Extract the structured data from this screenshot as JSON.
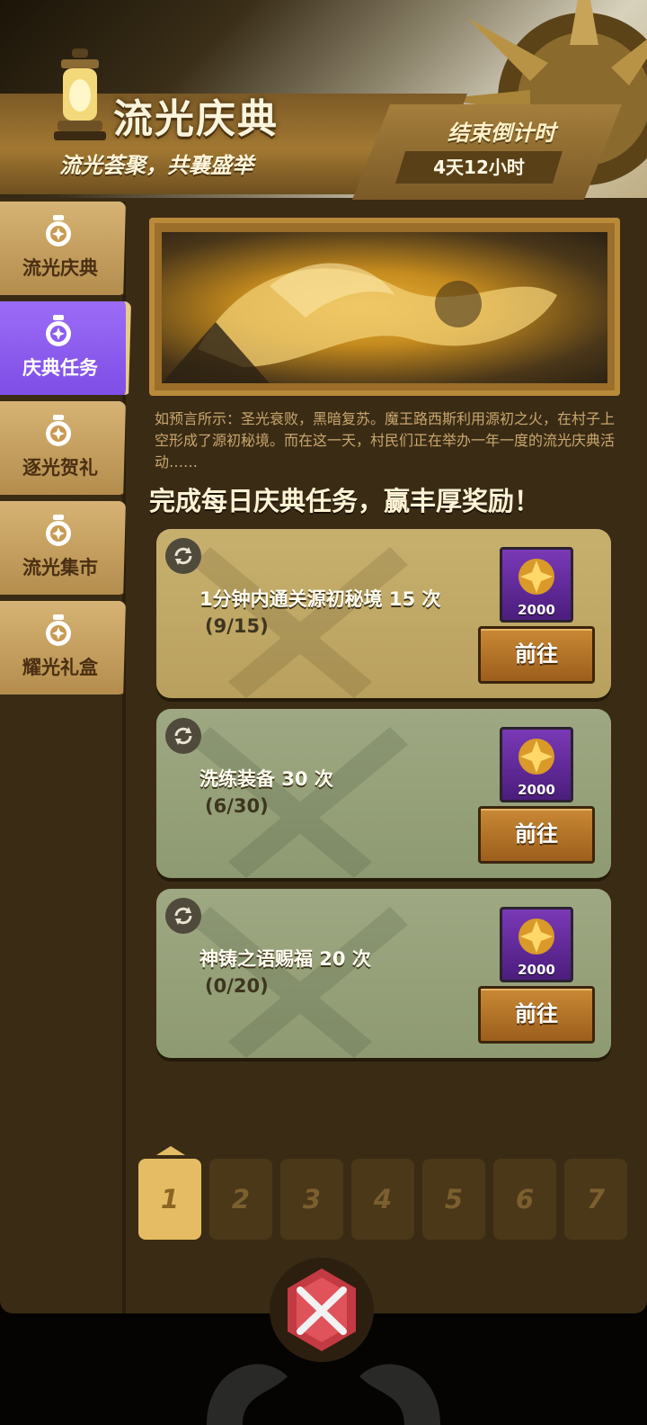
{
  "header": {
    "title": "流光庆典",
    "subtitle": "流光荟聚，共襄盛举",
    "countdown_label": "结束倒计时",
    "countdown_value": "4天12小时"
  },
  "sidebar": {
    "items": [
      {
        "label": "流光庆典",
        "icon": "lantern-badge-icon",
        "active": false
      },
      {
        "label": "庆典任务",
        "icon": "lantern-badge-icon",
        "active": true
      },
      {
        "label": "逐光贺礼",
        "icon": "lantern-badge-icon",
        "active": false
      },
      {
        "label": "流光集市",
        "icon": "lantern-badge-icon",
        "active": false
      },
      {
        "label": "耀光礼盒",
        "icon": "lantern-badge-icon",
        "active": false
      }
    ]
  },
  "story": "如预言所示：圣光衰败，黑暗复苏。魔王路西斯利用源初之火，在村子上空形成了源初秘境。而在这一天，村民们正在举办一年一度的流光庆典活动……",
  "headline": "完成每日庆典任务，赢丰厚奖励！",
  "tasks": [
    {
      "name": "1分钟内通关源初秘境 15 次",
      "progress": "(9/15)",
      "reward_count": "2000",
      "button": "前往"
    },
    {
      "name": "洗练装备 30 次",
      "progress": "(6/30)",
      "reward_count": "2000",
      "button": "前往"
    },
    {
      "name": "神铸之语赐福 20 次",
      "progress": "(0/20)",
      "reward_count": "2000",
      "button": "前往"
    }
  ],
  "days": [
    "1",
    "2",
    "3",
    "4",
    "5",
    "6",
    "7"
  ],
  "active_day": "1",
  "colors": {
    "panel": "#3a2b15",
    "active_tab": "#8a5cf0",
    "gold_card": "#c7b06e",
    "green_card": "#9ea882",
    "day_active": "#e5bc63"
  }
}
